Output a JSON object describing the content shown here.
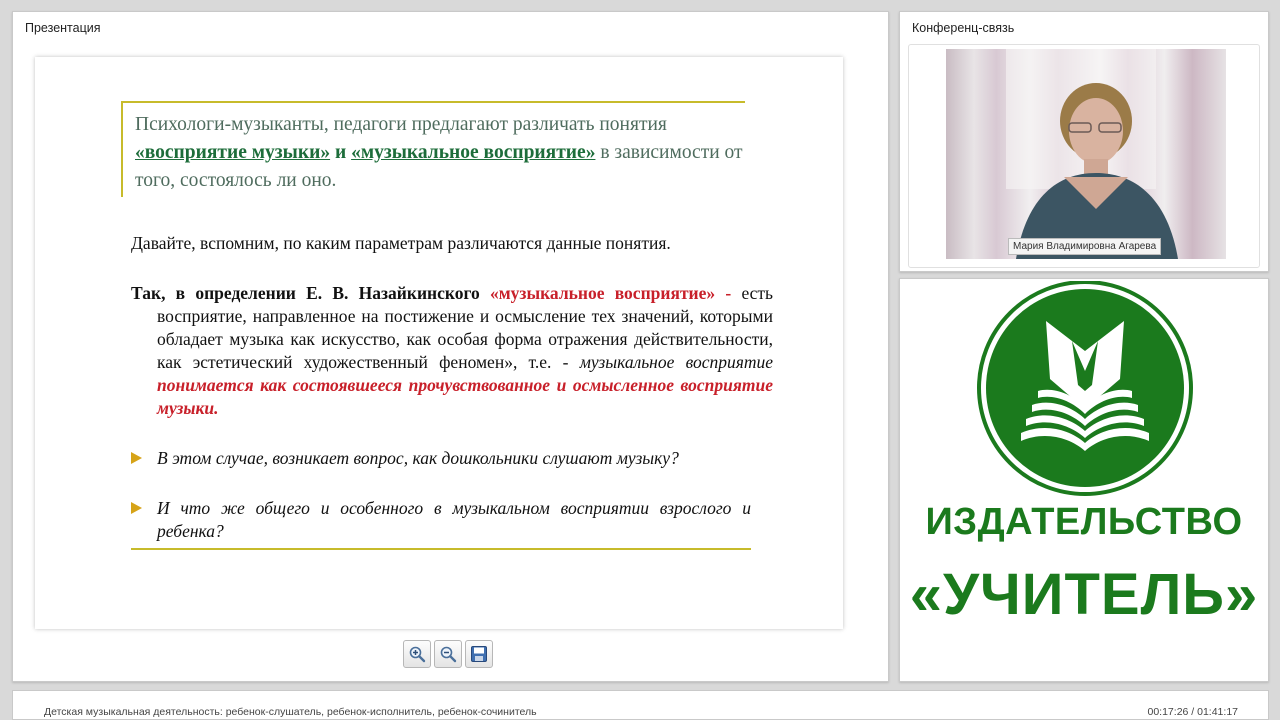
{
  "presentation_panel": {
    "title": "Презентация"
  },
  "slide": {
    "header": {
      "part1": "Психологи-музыканты, педагоги предлагают различать понятия",
      "term1": "«восприятие музыки»",
      "and": "и",
      "term2": "«музыкальное восприятие»",
      "part2": "в зависимости от того, состоялось ли оно."
    },
    "para1": "Давайте, вспомним, по каким параметрам различаются данные понятия.",
    "para2": {
      "lead": "Так, в определении Е. В. Назайкинского",
      "quote": "«музыкальное восприятие» -",
      "text": "есть восприятие, направленное на постижение и осмысление тех значений, которыми обладает музыка как искусство, как особая форма отражения действительности, как эстетический художественный феномен», т.е. -",
      "italic": "музыкальное восприятие",
      "emph": "понимается как состоявшееся прочувствованное и осмысленное восприятие музыки."
    },
    "bullets": [
      "В этом случае, возникает вопрос, как дошкольники слушают музыку?",
      "И что же общего и особенного в музыкальном восприятии взрослого и ребенка?"
    ]
  },
  "toolbar": {
    "zoom_in_icon": "zoom-in",
    "zoom_out_icon": "zoom-out",
    "save_icon": "floppy-disk"
  },
  "conference_panel": {
    "title": "Конференц-связь",
    "participant_name": "Мария Владимировна Агарева"
  },
  "logo": {
    "line1": "ИЗДАТЕЛЬСТВО",
    "line2": "«УЧИТЕЛЬ»",
    "color": "#1b7a1d"
  },
  "footer": {
    "title": "Детская музыкальная деятельность: ребенок-слушатель, ребенок-исполнитель, ребенок-сочинитель",
    "time": "00:17:26 / 01:41:17"
  }
}
